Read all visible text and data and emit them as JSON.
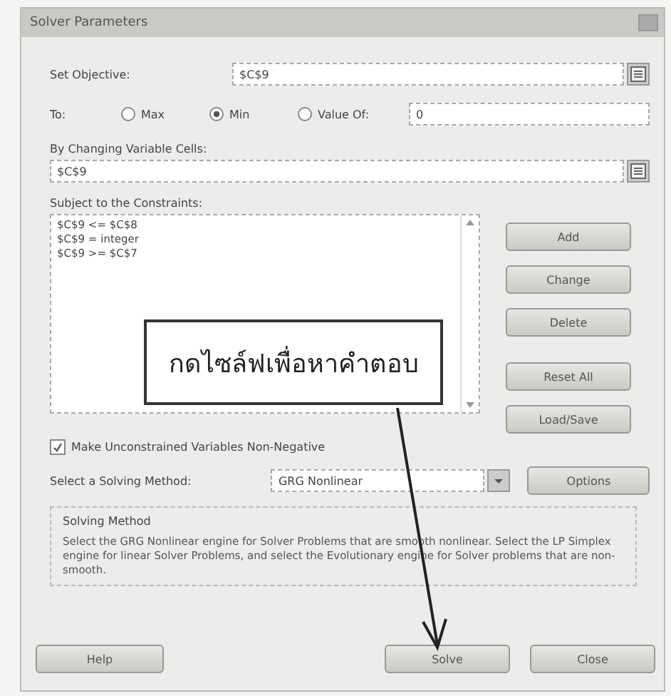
{
  "window": {
    "title": "Solver Parameters"
  },
  "objective": {
    "label": "Set Objective:",
    "value": "$C$9"
  },
  "to": {
    "label": "To:",
    "options": [
      {
        "label": "Max",
        "selected": false
      },
      {
        "label": "Min",
        "selected": true
      },
      {
        "label": "Value Of:",
        "selected": false
      }
    ],
    "value": "0"
  },
  "changing": {
    "label": "By Changing Variable Cells:",
    "value": "$C$9"
  },
  "constraints": {
    "label": "Subject to the Constraints:",
    "items": [
      "$C$9 <= $C$8",
      "$C$9 = integer",
      "$C$9 >= $C$7"
    ]
  },
  "constraint_buttons": [
    "Add",
    "Change",
    "Delete",
    "Reset All",
    "Load/Save"
  ],
  "nonnegative": {
    "label": "Make Unconstrained Variables Non-Negative",
    "checked": true
  },
  "method": {
    "label": "Select a Solving Method:",
    "value": "GRG Nonlinear",
    "button": "Options"
  },
  "method_info": {
    "title": "Solving Method",
    "text": "Select the GRG Nonlinear engine for Solver Problems that are smooth nonlinear. Select the LP Simplex engine for linear Solver Problems, and select the Evolutionary engine for Solver problems that are non-smooth."
  },
  "footer_buttons": [
    "Help",
    "Solve",
    "Close"
  ],
  "callout": {
    "text": "กดไซล์ฟเพื่อหาคำตอบ"
  }
}
